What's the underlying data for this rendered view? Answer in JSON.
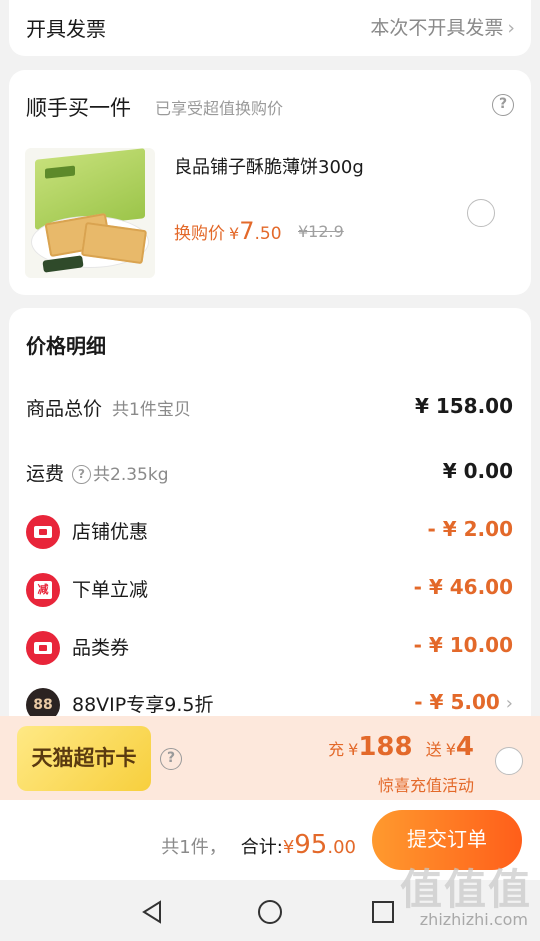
{
  "invoice": {
    "label": "开具发票",
    "value": "本次不开具发票",
    "chevron": "›"
  },
  "buy_one": {
    "title": "顺手买一件",
    "subtitle": "已享受超值换购价",
    "help_icon": "?",
    "product": {
      "name": "良品铺子酥脆薄饼300g",
      "price_label": "换购价",
      "yen": "¥",
      "price_int": "7",
      "price_dec": ".50",
      "original_price": "¥12.9"
    }
  },
  "price_detail": {
    "title": "价格明细",
    "rows": [
      {
        "label": "商品总价",
        "sub": "共1件宝贝",
        "value": "¥ 158.00"
      },
      {
        "label": "运费",
        "help": "?",
        "sub": "共2.35kg",
        "value": "¥ 0.00"
      },
      {
        "label": "店铺优惠",
        "icon": "ticket-icon",
        "value": "- ¥ 2.00"
      },
      {
        "label": "下单立减",
        "icon": "jian-icon",
        "icon_text": "减",
        "value": "- ¥ 46.00"
      },
      {
        "label": "品类券",
        "icon": "ticket-icon",
        "value": "- ¥ 10.00"
      },
      {
        "label": "88VIP专享9.5折",
        "icon": "vip88-icon",
        "icon_text": "88",
        "value": "- ¥ 5.00",
        "chevron": "›"
      }
    ]
  },
  "tmall_card": {
    "badge": "天猫超市卡",
    "help_icon": "?",
    "charge_label": "充",
    "charge_yen": "¥",
    "charge_amount": "188",
    "gift_label": "送",
    "gift_yen": "¥",
    "gift_amount": "4",
    "activity": "惊喜充值活动"
  },
  "submit_bar": {
    "count": "共1件，",
    "total_label": "合计:",
    "yen": "¥",
    "total_int": "95",
    "total_dec": ".00",
    "submit": "提交订单"
  },
  "watermark": {
    "big": "值值值",
    "small": "zhizhizhi.com"
  },
  "colors": {
    "accent": "#e3692a",
    "red": "#e8253a",
    "button_gradient": [
      "#ff9a2e",
      "#ff5e1a"
    ]
  }
}
